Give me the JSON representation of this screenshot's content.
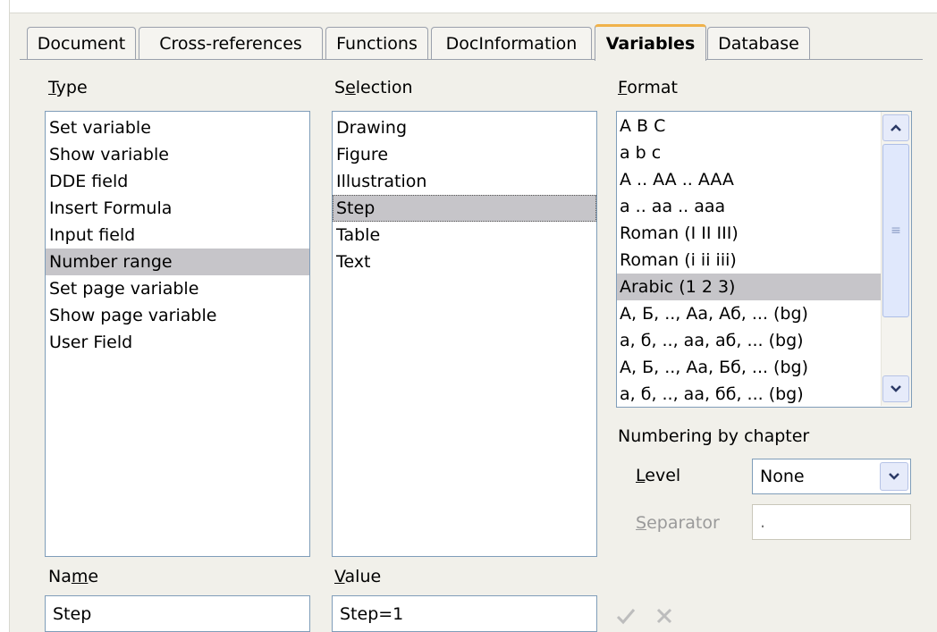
{
  "tabs": [
    {
      "label": "Document",
      "active": false
    },
    {
      "label": "Cross-references",
      "active": false
    },
    {
      "label": "Functions",
      "active": false
    },
    {
      "label": "DocInformation",
      "active": false
    },
    {
      "label": "Variables",
      "active": true
    },
    {
      "label": "Database",
      "active": false
    }
  ],
  "type": {
    "label_pre": "",
    "label_accel": "T",
    "label_post": "ype",
    "items": [
      "Set variable",
      "Show variable",
      "DDE field",
      "Insert Formula",
      "Input field",
      "Number range",
      "Set page variable",
      "Show page variable",
      "User Field"
    ],
    "selected_index": 5
  },
  "selection": {
    "label_pre": "S",
    "label_accel": "e",
    "label_post": "lection",
    "items": [
      "Drawing",
      "Figure",
      "Illustration",
      "Step",
      "Table",
      "Text"
    ],
    "selected_index": 3
  },
  "format": {
    "label_pre": "",
    "label_accel": "F",
    "label_post": "ormat",
    "items": [
      "A B C",
      "a b c",
      "A .. AA .. AAA",
      "a .. aa .. aaa",
      "Roman (I II III)",
      "Roman (i ii iii)",
      "Arabic (1 2 3)",
      "А, Б, .., Аа, Аб, ... (bg)",
      "а, б, .., аа, аб, ... (bg)",
      "А, Б, .., Аа, Бб, ... (bg)",
      "а, б, .., аа, бб, ... (bg)"
    ],
    "selected_index": 6
  },
  "numbering": {
    "title": "Numbering by chapter",
    "level_pre": "",
    "level_accel": "L",
    "level_post": "evel",
    "level_value": "None",
    "separator_pre": "",
    "separator_accel": "S",
    "separator_post": "eparator",
    "separator_value": "."
  },
  "name": {
    "label_pre": "Na",
    "label_accel": "m",
    "label_post": "e",
    "value": "Step"
  },
  "value": {
    "label_pre": "",
    "label_accel": "V",
    "label_post": "alue",
    "value": "Step=1"
  },
  "icons": {
    "apply": "check-icon",
    "delete": "x-icon",
    "scroll_up": "chevron-up-icon",
    "scroll_down": "chevron-down-icon",
    "combo": "chevron-down-icon"
  },
  "colors": {
    "active_tab_accent": "#f0b24a",
    "selection": "#c6c5c9",
    "dialog_bg": "#f1f0ea"
  }
}
